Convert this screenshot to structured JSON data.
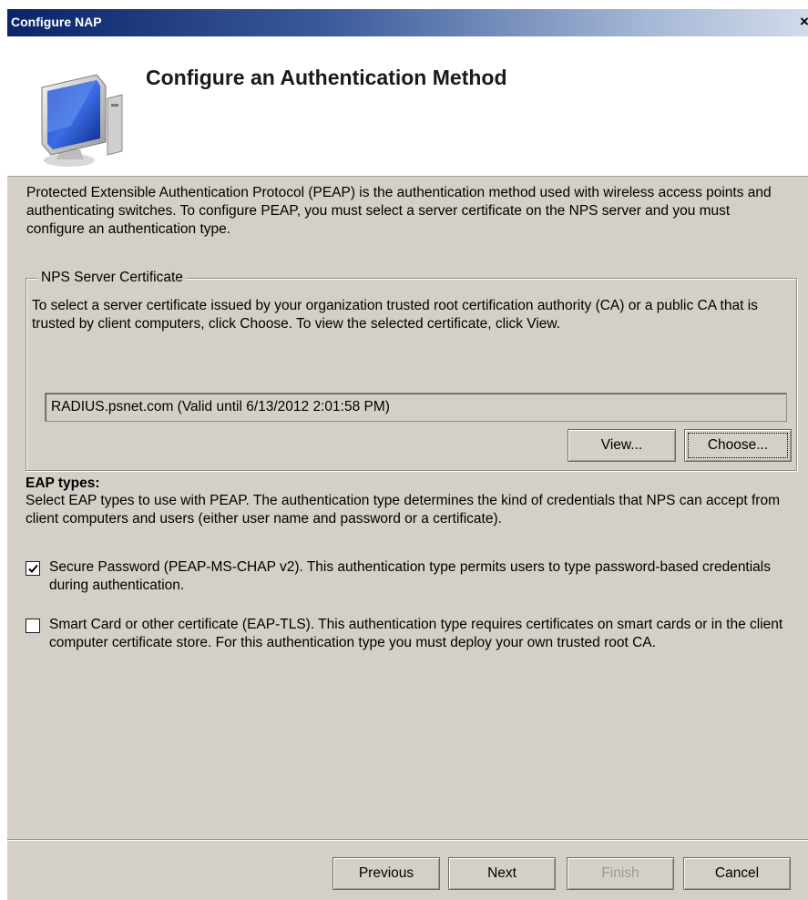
{
  "window": {
    "title": "Configure NAP",
    "close_glyph": "×"
  },
  "header": {
    "title": "Configure an Authentication Method",
    "icon": "computer-monitor-icon"
  },
  "intro_text": "Protected Extensible Authentication Protocol (PEAP) is the authentication method used with wireless access points and authenticating switches. To configure PEAP, you must select a server certificate on the NPS server and you must configure an authentication type.",
  "nps_certificate": {
    "legend": "NPS Server Certificate",
    "description": "To select a server certificate issued by your organization trusted root certification authority (CA) or a public CA that is trusted by client computers, click Choose. To view the selected certificate, click View.",
    "selected_certificate": "RADIUS.psnet.com (Valid until 6/13/2012 2:01:58 PM)",
    "view_button": "View...",
    "choose_button": "Choose..."
  },
  "eap": {
    "heading": "EAP types:",
    "description": "Select EAP types to use with PEAP. The authentication type determines the kind of credentials that NPS can accept from client computers and users (either user name and password or a certificate).",
    "options": [
      {
        "label": "Secure Password (PEAP-MS-CHAP v2). This authentication type permits users to type password-based credentials during authentication.",
        "checked": true
      },
      {
        "label": "Smart Card or other certificate (EAP-TLS). This authentication type requires certificates on smart cards or in the client computer certificate store. For this authentication type you must deploy your own trusted root CA.",
        "checked": false
      }
    ]
  },
  "footer": {
    "previous": "Previous",
    "next": "Next",
    "finish": "Finish",
    "cancel": "Cancel",
    "finish_enabled": false
  },
  "colors": {
    "dialog_bg": "#d4d0c8",
    "title_bar_start": "#0a246a",
    "header_bg": "#ffffff",
    "disabled_text": "#9a9a9a"
  }
}
